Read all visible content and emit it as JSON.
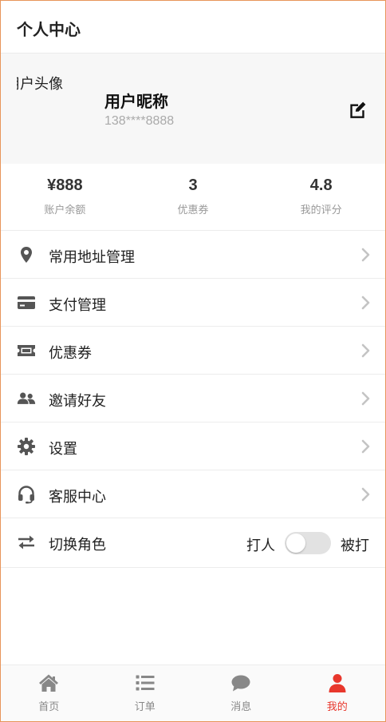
{
  "header": {
    "title": "个人中心"
  },
  "profile": {
    "avatar_alt": "用户头像",
    "nickname": "用户昵称",
    "phone": "138****8888"
  },
  "stats": [
    {
      "value": "¥888",
      "label": "账户余额"
    },
    {
      "value": "3",
      "label": "优惠券"
    },
    {
      "value": "4.8",
      "label": "我的评分"
    }
  ],
  "menu": [
    {
      "label": "常用地址管理",
      "icon": "map-marker-icon"
    },
    {
      "label": "支付管理",
      "icon": "credit-card-icon"
    },
    {
      "label": "优惠券",
      "icon": "ticket-icon"
    },
    {
      "label": "邀请好友",
      "icon": "users-icon"
    },
    {
      "label": "设置",
      "icon": "gear-icon"
    },
    {
      "label": "客服中心",
      "icon": "headset-icon"
    }
  ],
  "role_switch": {
    "label": "切换角色",
    "icon": "exchange-icon",
    "left_option": "打人",
    "right_option": "被打",
    "state": "off"
  },
  "tabbar": [
    {
      "label": "首页",
      "icon": "home-icon"
    },
    {
      "label": "订单",
      "icon": "list-icon"
    },
    {
      "label": "消息",
      "icon": "chat-bubble-icon"
    },
    {
      "label": "我的",
      "icon": "user-icon",
      "active": true
    }
  ],
  "colors": {
    "accent": "#e8372c",
    "icon_gray": "#555555",
    "tab_gray": "#888888",
    "frame_border": "#e8955a"
  }
}
